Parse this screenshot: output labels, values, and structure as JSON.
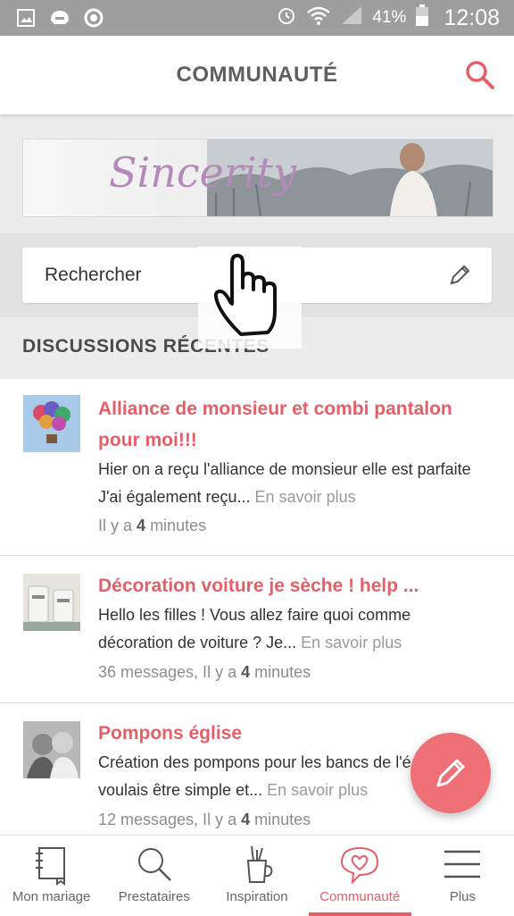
{
  "status_bar": {
    "battery": "41%",
    "time": "12:08"
  },
  "header": {
    "title": "COMMUNAUTÉ"
  },
  "banner": {
    "brand": "Sincerity"
  },
  "search": {
    "placeholder": "Rechercher"
  },
  "section": {
    "title": "DISCUSSIONS RÉCENTES"
  },
  "discussions": [
    {
      "title_line1": "Alliance de monsieur et combi pantalon",
      "title_line2": "pour moi!!!",
      "excerpt_line1": "Hier on a reçu l'alliance de monsieur elle est parfaite",
      "excerpt_line2": "J'ai également reçu...",
      "more": "En savoir plus",
      "meta_prefix": "Il y a",
      "meta_bold": "4",
      "meta_suffix": "minutes"
    },
    {
      "title_line1": "Décoration voiture je sèche ! help ...",
      "excerpt_line1": "Hello les filles ! Vous allez faire quoi comme",
      "excerpt_line2": "décoration de voiture ? Je...",
      "more": "En savoir plus",
      "meta_prefix": "36 messages, Il y a",
      "meta_bold": "4",
      "meta_suffix": "minutes"
    },
    {
      "title_line1": "Pompons église",
      "excerpt_line1": "Création des pompons pour les bancs de l'é",
      "excerpt_line2": "voulais être simple et...",
      "more": "En savoir plus",
      "meta_prefix": "12 messages, Il y a",
      "meta_bold": "4",
      "meta_suffix": "minutes"
    }
  ],
  "bottom_nav": [
    {
      "label": "Mon mariage",
      "icon": "notebook-icon"
    },
    {
      "label": "Prestataires",
      "icon": "magnifier-icon"
    },
    {
      "label": "Inspiration",
      "icon": "pencil-cup-icon"
    },
    {
      "label": "Communauté",
      "icon": "heart-bubble-icon",
      "active": true
    },
    {
      "label": "Plus",
      "icon": "hamburger-icon"
    }
  ],
  "colors": {
    "accent": "#e45f67",
    "fab": "#ef6f76",
    "status_bar": "#9e9e9e"
  }
}
